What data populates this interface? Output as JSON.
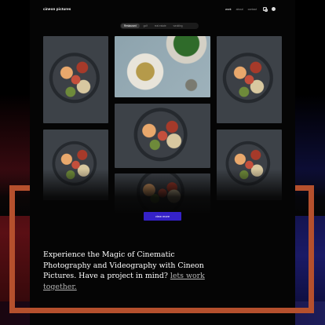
{
  "brand": {
    "name": "cineon pictures"
  },
  "nav": {
    "items": [
      {
        "label": "work",
        "active": true
      },
      {
        "label": "about",
        "active": false
      },
      {
        "label": "contact",
        "active": false
      }
    ],
    "icons": [
      "instagram-icon",
      "facebook-icon"
    ]
  },
  "filters": {
    "items": [
      {
        "label": "Restaurant",
        "active": true
      },
      {
        "label": "golf",
        "active": false
      },
      {
        "label": "real estate",
        "active": false
      },
      {
        "label": "wedding",
        "active": false
      }
    ]
  },
  "gallery": {
    "tiles": [
      {
        "subject": "seafood pasta on dark plate"
      },
      {
        "subject": "noodle bowl with greens and lime"
      },
      {
        "subject": "seafood pasta on dark plate"
      },
      {
        "subject": "seafood pasta on dark plate"
      },
      {
        "subject": "seafood pasta on dark plate"
      },
      {
        "subject": "seafood pasta on dark plate"
      },
      {
        "subject": "seafood pasta on dark plate"
      }
    ]
  },
  "view_more": {
    "label": "view more"
  },
  "cta": {
    "text": "Experience the Magic of Cinematic Photography and Videography with Cineon Pictures. Have a project in mind?",
    "link_label": "lets work together."
  },
  "colors": {
    "accent_button": "#3522c8",
    "frame": "#b5502d",
    "background": "#050505"
  }
}
